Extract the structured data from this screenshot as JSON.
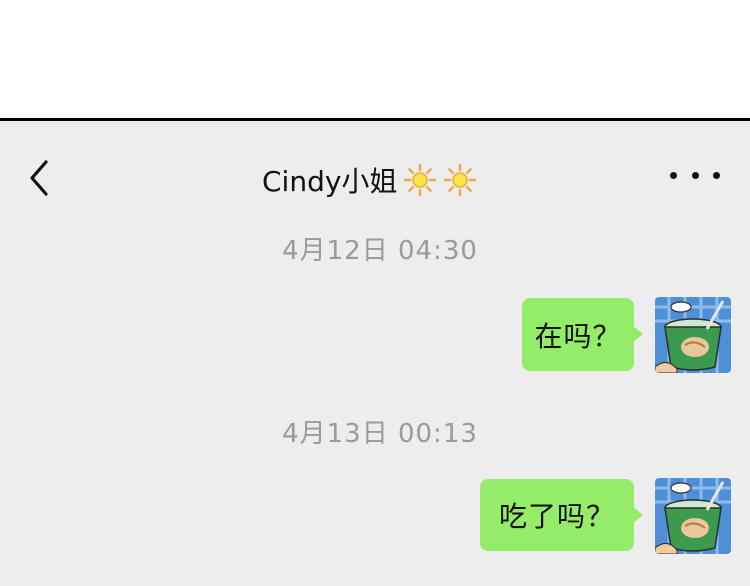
{
  "header": {
    "title": "Cindy小姐",
    "title_icons": [
      "sun-icon",
      "sun-icon"
    ],
    "back_icon": "chevron-left-icon",
    "more_icon": "more-dots-icon"
  },
  "messages": [
    {
      "timestamp": "4月12日  04:30",
      "text": "在吗？",
      "sender": "self",
      "avatar": "noodle-cup-avatar"
    },
    {
      "timestamp": "4月13日  00:13",
      "text": "吃了吗？",
      "sender": "self",
      "avatar": "noodle-cup-avatar"
    }
  ],
  "colors": {
    "chat_background": "#ededed",
    "bubble_self": "#95ec69",
    "timestamp_text": "#9a9a9a",
    "title_text": "#111111"
  }
}
